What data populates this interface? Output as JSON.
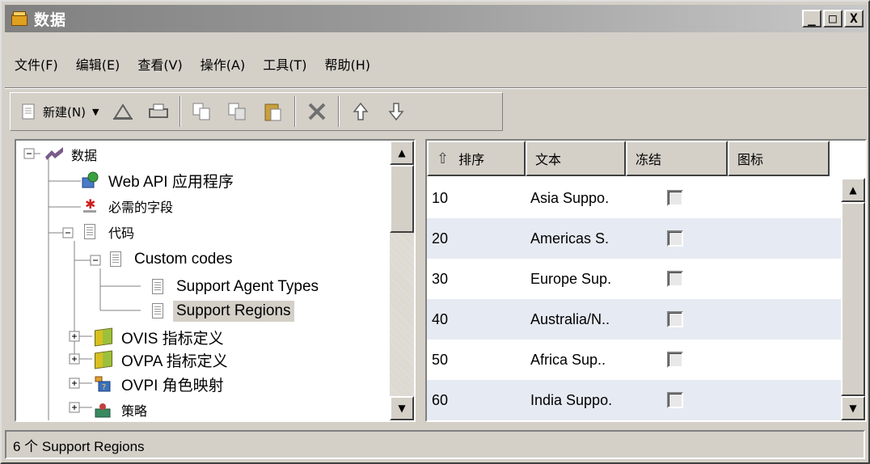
{
  "window": {
    "title": "数据",
    "minimize_label": "_",
    "maximize_label": "□",
    "close_label": "X"
  },
  "menu": [
    {
      "label": "文件(F)"
    },
    {
      "label": "编辑(E)"
    },
    {
      "label": "查看(V)"
    },
    {
      "label": "操作(A)"
    },
    {
      "label": "工具(T)"
    },
    {
      "label": "帮助(H)"
    }
  ],
  "toolbar": {
    "new_label": "新建(N)",
    "buttons": [
      "new-icon",
      "erase-icon",
      "print-icon",
      "copy-icon",
      "duplicate-icon",
      "paste-icon",
      "delete-icon",
      "move-up-icon",
      "move-down-icon"
    ]
  },
  "tree": {
    "root": "数据",
    "items": [
      {
        "label": "Web API 应用程序",
        "icon": "web-api-icon"
      },
      {
        "label": "必需的字段",
        "icon": "required-field-icon"
      },
      {
        "label": "代码",
        "icon": "document-icon"
      },
      {
        "label": "Custom codes",
        "icon": "document-icon"
      },
      {
        "label": "Support Agent Types",
        "icon": "document-icon"
      },
      {
        "label": "Support Regions",
        "icon": "document-icon",
        "selected": true
      },
      {
        "label": "OVIS 指标定义",
        "icon": "book-icon"
      },
      {
        "label": "OVPA 指标定义",
        "icon": "book-icon"
      },
      {
        "label": "OVPI 角色映射",
        "icon": "role-map-icon"
      },
      {
        "label": "策略",
        "icon": "policy-icon"
      }
    ]
  },
  "grid": {
    "columns": [
      "排序",
      "文本",
      "冻结",
      "图标"
    ],
    "rows": [
      {
        "order": "10",
        "text": "Asia Suppo.",
        "frozen": false
      },
      {
        "order": "20",
        "text": "Americas S.",
        "frozen": false
      },
      {
        "order": "30",
        "text": "Europe Sup.",
        "frozen": false
      },
      {
        "order": "40",
        "text": "Australia/N..",
        "frozen": false
      },
      {
        "order": "50",
        "text": "Africa Sup..",
        "frozen": false
      },
      {
        "order": "60",
        "text": "India Suppo.",
        "frozen": false
      }
    ]
  },
  "status": {
    "text": "6 个 Support Regions"
  },
  "colors": {
    "title_bar": "#808080",
    "face": "#d4d0c8",
    "alt_row": "#e6eaf2",
    "selection": "#d4d0c8"
  }
}
